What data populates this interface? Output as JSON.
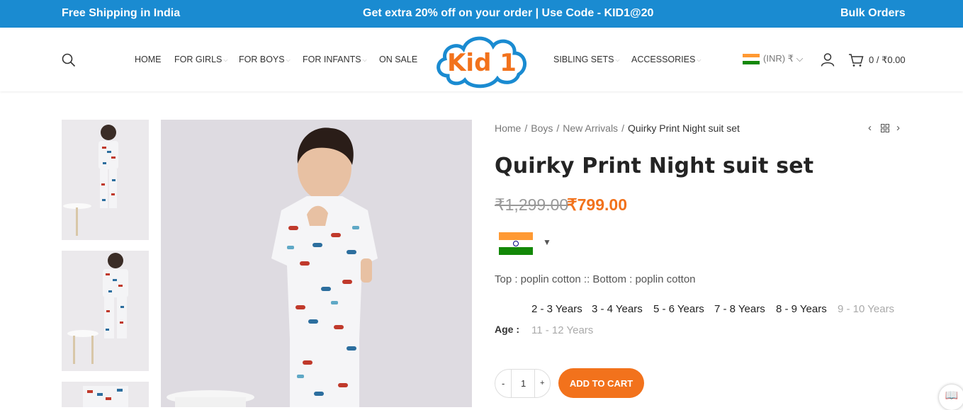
{
  "topbar": {
    "left": "Free Shipping in India",
    "center": "Get extra 20% off on your order | Use Code - KID1@20",
    "right": "Bulk Orders"
  },
  "nav": {
    "left": [
      {
        "label": "HOME",
        "dropdown": false
      },
      {
        "label": "FOR GIRLS",
        "dropdown": true
      },
      {
        "label": "FOR BOYS",
        "dropdown": true
      },
      {
        "label": "FOR INFANTS",
        "dropdown": true
      },
      {
        "label": "ON SALE",
        "dropdown": false
      }
    ],
    "right": [
      {
        "label": "SIBLING SETS",
        "dropdown": true
      },
      {
        "label": "ACCESSORIES",
        "dropdown": true
      }
    ]
  },
  "logo": {
    "text": "Kid 1",
    "color": "#f2721c",
    "cloud_color": "#1a8bd1"
  },
  "currency": "(INR) ₹",
  "cart": "0 / ₹0.00",
  "breadcrumb": [
    "Home",
    "Boys",
    "New Arrivals",
    "Quirky Print Night suit set"
  ],
  "product": {
    "title": "Quirky Print Night suit set",
    "price_old": "₹1,299.00",
    "price_new": "₹799.00",
    "material": "Top : poplin cotton :: Bottom : poplin cotton",
    "age_label": "Age",
    "ages": [
      {
        "label": "2 - 3 Years",
        "available": true
      },
      {
        "label": "3 - 4 Years",
        "available": true
      },
      {
        "label": "5 - 6 Years",
        "available": true
      },
      {
        "label": "7 - 8 Years",
        "available": true
      },
      {
        "label": "8 - 9 Years",
        "available": true
      },
      {
        "label": "9 - 10 Years",
        "available": false
      },
      {
        "label": "11 - 12 Years",
        "available": false
      }
    ],
    "quantity": "1",
    "add_to_cart": "ADD TO CART"
  },
  "colors": {
    "accent": "#f2721c",
    "topbar": "#1a8bd1"
  },
  "icons": {
    "qty_minus": "-",
    "qty_plus": "+",
    "flag_dropdown": "▼",
    "reader": "book-icon"
  }
}
